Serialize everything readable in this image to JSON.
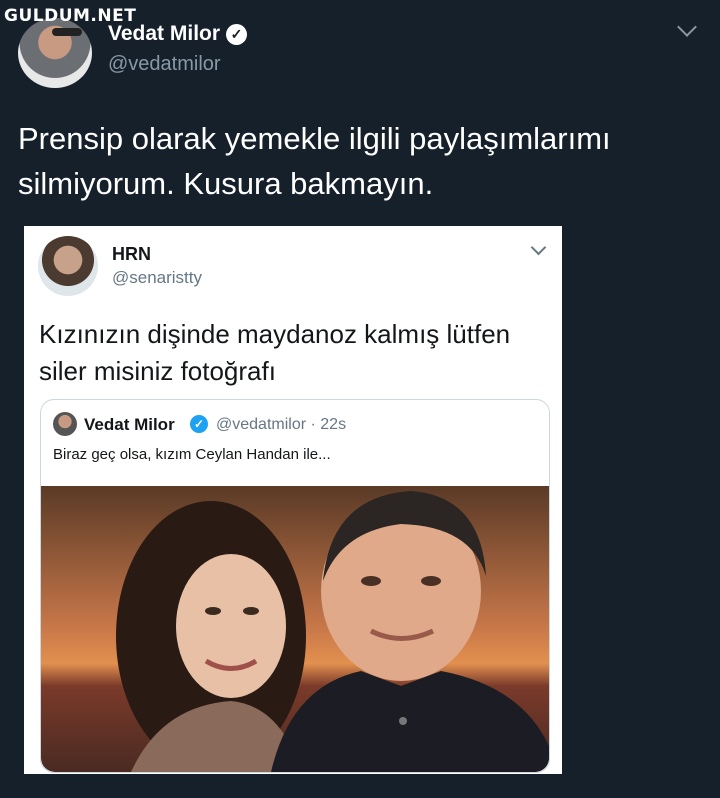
{
  "watermark": "GULDUM.NET",
  "tweet": {
    "display_name": "Vedat Milor",
    "handle": "@vedatmilor",
    "verified_glyph": "✓",
    "text": "Prensip olarak yemekle ilgili paylaşımlarımı silmiyorum. Kusura bakmayın."
  },
  "embedded_tweet": {
    "display_name": "HRN",
    "handle": "@senaristty",
    "text": "Kızınızın dişinde maydanoz kalmış lütfen siler misiniz fotoğrafı",
    "quoted": {
      "display_name": "Vedat Milor",
      "verified_glyph": "✓",
      "meta": "@vedatmilor · 22s",
      "text": "Biraz geç olsa, kızım Ceylan Handan ile..."
    }
  },
  "icons": {
    "menu_chevron": "chevron-down-icon",
    "verified": "verified-badge-icon"
  },
  "colors": {
    "background": "#15202b",
    "card": "#ffffff",
    "secondary_text_dark": "#8899a6",
    "secondary_text_light": "#657786",
    "verified_blue": "#1da1f2"
  }
}
